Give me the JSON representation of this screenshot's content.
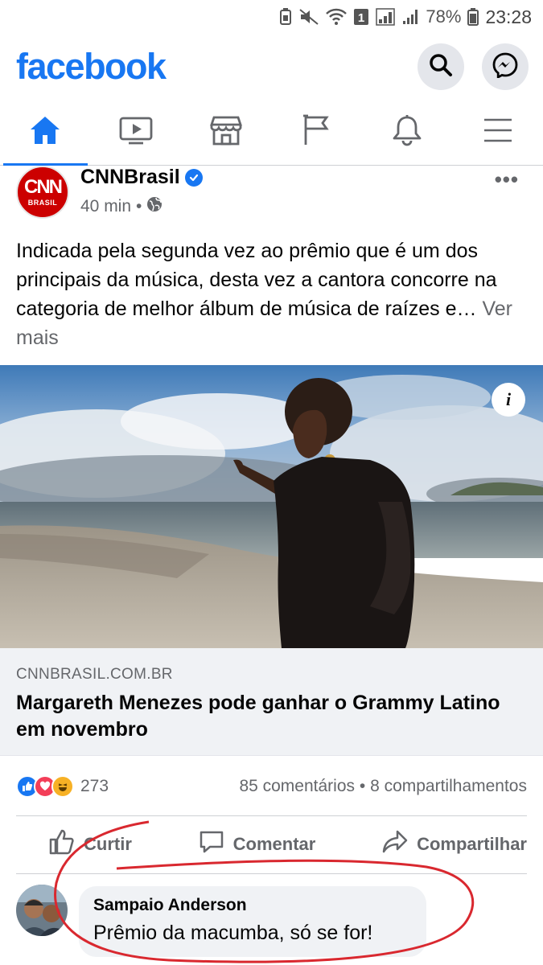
{
  "status_bar": {
    "battery": "78%",
    "time": "23:28",
    "sim_slot": "1"
  },
  "header": {
    "logo": "facebook",
    "search_icon": "search-icon",
    "messenger_icon": "messenger-icon",
    "brand_color": "#1877f2"
  },
  "tabs": [
    {
      "icon": "home-icon",
      "active": true
    },
    {
      "icon": "watch-icon",
      "active": false
    },
    {
      "icon": "marketplace-icon",
      "active": false
    },
    {
      "icon": "pages-flag-icon",
      "active": false
    },
    {
      "icon": "notifications-bell-icon",
      "active": false
    },
    {
      "icon": "menu-icon",
      "active": false
    }
  ],
  "post": {
    "page_name": "CNNBrasil",
    "avatar_text": "CNN",
    "avatar_sub": "BRASIL",
    "time": "40 min",
    "separator": "•",
    "more": "•••",
    "text": "Indicada pela segunda vez ao prêmio que é um dos principais da música, desta vez a cantora concorre na categoria de melhor álbum de música de raízes e…",
    "see_more": "Ver mais",
    "info_icon": "i",
    "link": {
      "domain": "CNNBRASIL.COM.BR",
      "title": "Margareth Menezes pode ganhar o Grammy Latino em novembro"
    },
    "reactions": {
      "count": "273",
      "comments": "85 comentários",
      "dot": "•",
      "shares": "8 compartilhamentos"
    },
    "actions": {
      "like": "Curtir",
      "comment": "Comentar",
      "share": "Compartilhar"
    }
  },
  "comment": {
    "author": "Sampaio Anderson",
    "text": "Prêmio da macumba, só se for!"
  }
}
